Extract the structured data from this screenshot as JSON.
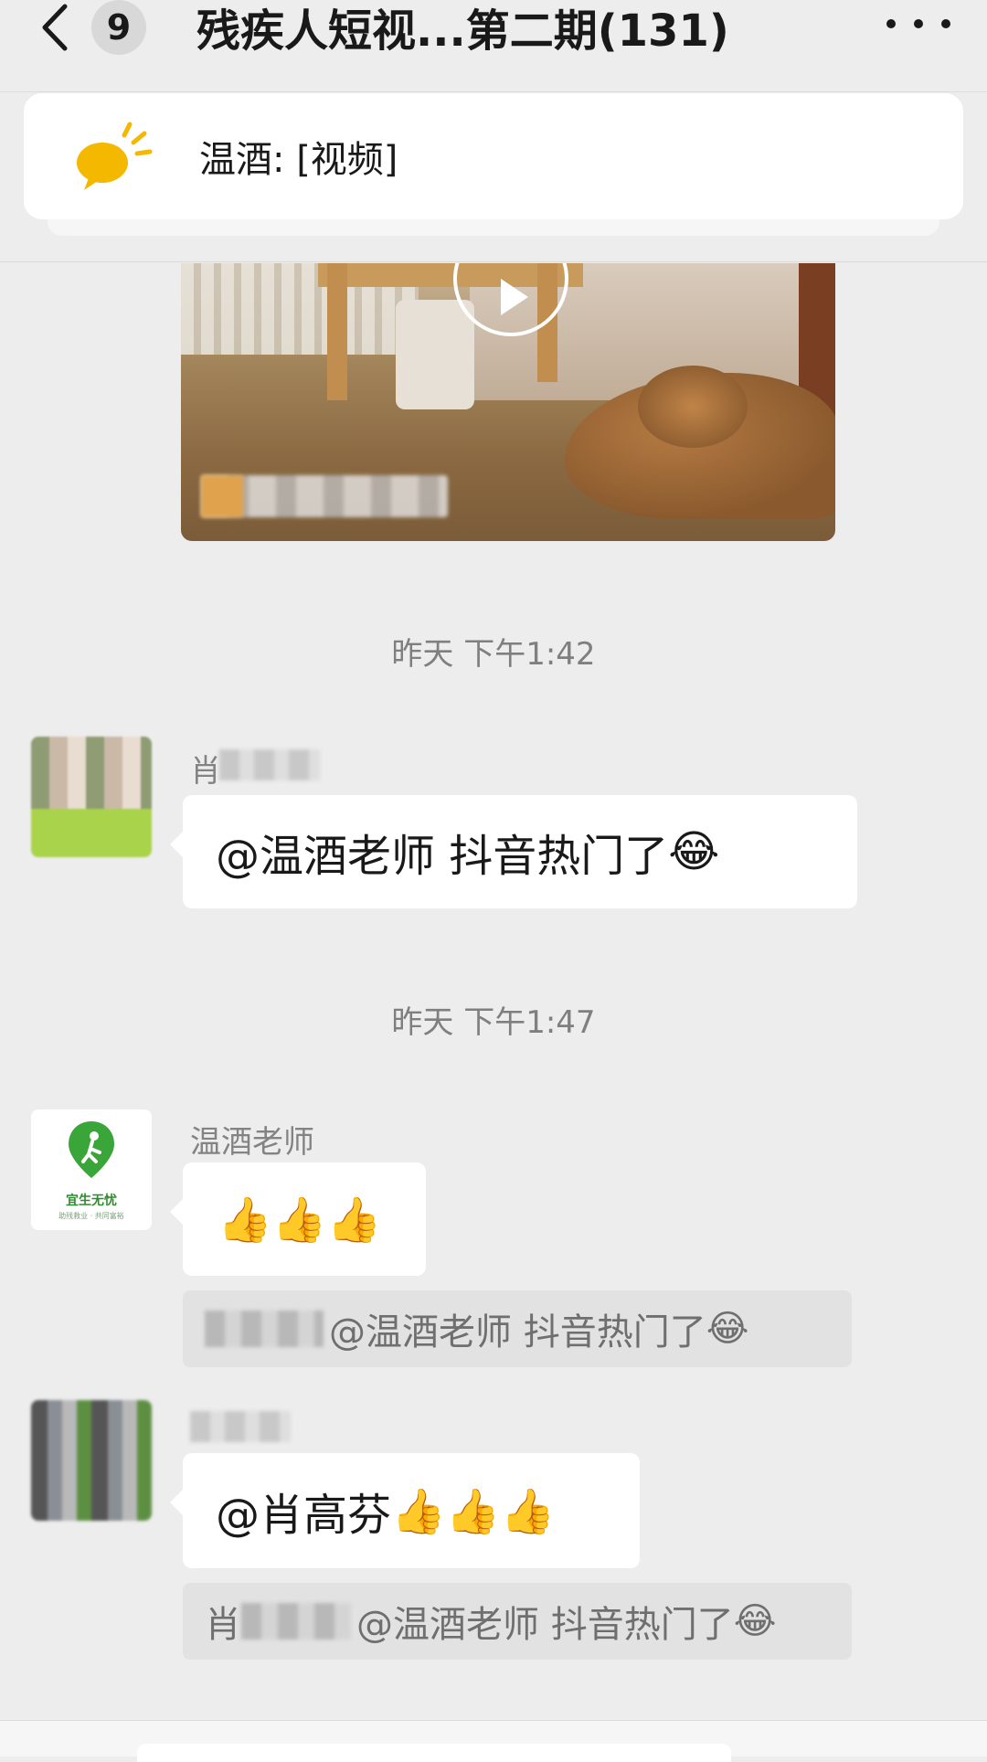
{
  "nav": {
    "back_label": "<",
    "unread_count": "9",
    "title": "残疾人短视...第二期(131)",
    "more_label": "..."
  },
  "notice": {
    "text": "温酒: [视频]",
    "icon": "speech-bubble-icon"
  },
  "video": {
    "play_icon": "play-icon"
  },
  "timestamps": [
    "昨天 下午1:42",
    "昨天 下午1:47"
  ],
  "messages": [
    {
      "sender": "肖",
      "text": "@温酒老师  抖音热门了",
      "emoji": "😂"
    },
    {
      "sender": "温酒老师",
      "emoji": "👍👍👍",
      "avatar_text": "宜生无忧",
      "avatar_subtext": "助残救业 · 共同富裕",
      "quote_text": "@温酒老师 抖音热门了",
      "quote_emoji": "😂"
    },
    {
      "sender": "",
      "text": "@肖高芬 ",
      "emoji": "👍👍👍",
      "quote_prefix": "肖",
      "quote_text": "@温酒老师 抖音热门了",
      "quote_emoji": "😂"
    }
  ],
  "colors": {
    "background": "#ededed",
    "bubble": "#ffffff",
    "quote": "#e2e2e2",
    "timestamp": "#7f7f7f",
    "logo_green": "#3aa63a",
    "notice_icon": "#f5b800"
  }
}
